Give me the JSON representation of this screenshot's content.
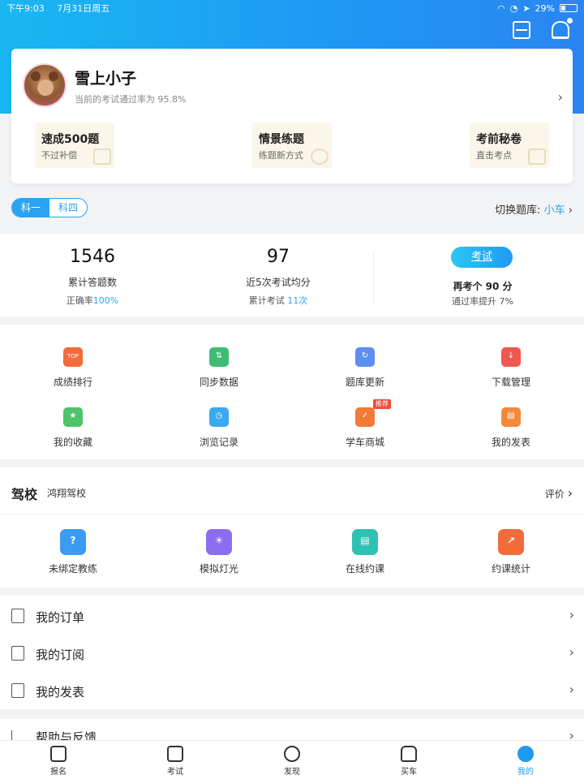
{
  "status_bar": {
    "time": "下午9:03",
    "date": "7月31日周五",
    "battery": "29%"
  },
  "profile": {
    "name": "雪上小子",
    "pass_rate_text": "当前的考试通过率为 95.8%",
    "promos": [
      {
        "title": "速成500题",
        "subtitle": "不过补偿"
      },
      {
        "title": "情景练题",
        "subtitle": "练题新方式"
      },
      {
        "title": "考前秘卷",
        "subtitle": "直击考点"
      }
    ]
  },
  "subjects": {
    "active": "科一",
    "inactive": "科四",
    "switch_label": "切换题库:",
    "switch_value": "小车"
  },
  "stats": {
    "total_answers": "1546",
    "total_answers_label": "累计答题数",
    "accuracy_label": "正确率",
    "accuracy": "100%",
    "avg_score": "97",
    "avg_score_label": "近5次考试均分",
    "exams_label": "累计考试",
    "exams": "11次",
    "exam_button": "考试",
    "retest_text": "再考个 90 分",
    "improve_text": "通过率提升 7%"
  },
  "grid": [
    {
      "label": "成绩排行",
      "icon": "trophy-icon",
      "glyph": "TOP",
      "color": "#f26b3a"
    },
    {
      "label": "同步数据",
      "icon": "sync-icon",
      "glyph": "⇅",
      "color": "#3dbd74"
    },
    {
      "label": "题库更新",
      "icon": "refresh-icon",
      "glyph": "↻",
      "color": "#5d8ef2"
    },
    {
      "label": "下载管理",
      "icon": "download-icon",
      "glyph": "↓",
      "color": "#f0584f"
    },
    {
      "label": "我的收藏",
      "icon": "star-icon",
      "glyph": "★",
      "color": "#4fc36b"
    },
    {
      "label": "浏览记录",
      "icon": "history-icon",
      "glyph": "◷",
      "color": "#3aa9ef"
    },
    {
      "label": "学车商城",
      "icon": "shop-icon",
      "glyph": "✓",
      "color": "#f27a36",
      "badge": "推荐"
    },
    {
      "label": "我的发表",
      "icon": "inbox-icon",
      "glyph": "▤",
      "color": "#f28a3a"
    }
  ],
  "school": {
    "title": "驾校",
    "name": "鸿翔驾校",
    "review": "评价",
    "items": [
      {
        "label": "未绑定教练",
        "icon": "question-icon",
        "glyph": "?",
        "color": "#3a9bf2"
      },
      {
        "label": "模拟灯光",
        "icon": "bulb-icon",
        "glyph": "☀",
        "color": "#8b6ef0"
      },
      {
        "label": "在线约课",
        "icon": "schedule-icon",
        "glyph": "▤",
        "color": "#2fc2b3"
      },
      {
        "label": "约课统计",
        "icon": "stats-icon",
        "glyph": "↗",
        "color": "#f26c3a"
      }
    ]
  },
  "list": [
    {
      "label": "我的订单",
      "icon": "order-icon"
    },
    {
      "label": "我的订阅",
      "icon": "bookmark-icon"
    },
    {
      "label": "我的发表",
      "icon": "post-icon"
    }
  ],
  "help": {
    "label": "帮助与反馈"
  },
  "tabs": [
    {
      "label": "报名",
      "icon": "signup-icon"
    },
    {
      "label": "考试",
      "icon": "exam-folder-icon"
    },
    {
      "label": "发现",
      "icon": "compass-icon"
    },
    {
      "label": "买车",
      "icon": "car-icon"
    },
    {
      "label": "我的",
      "icon": "profile-icon",
      "active": true
    }
  ]
}
